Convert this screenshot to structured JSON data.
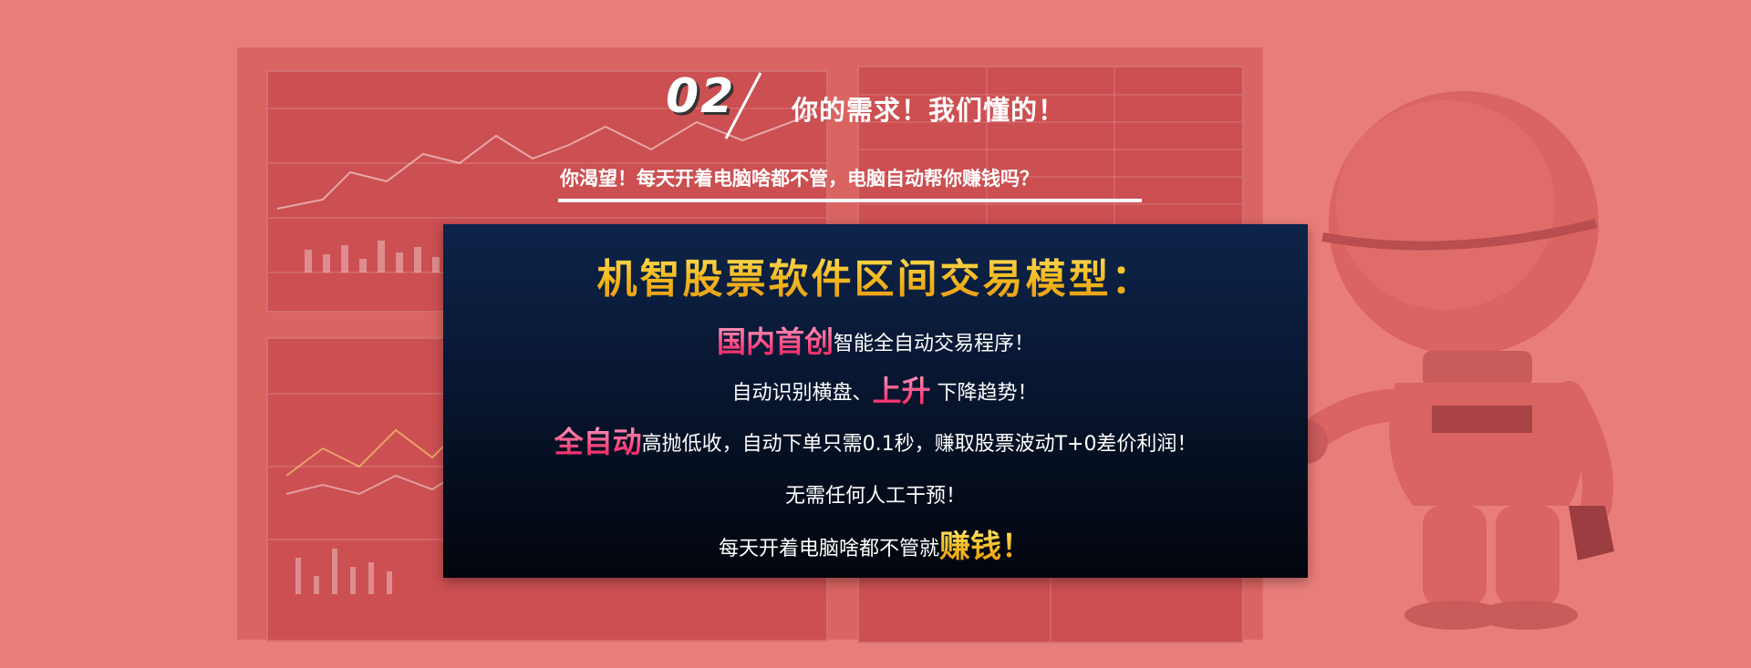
{
  "header": {
    "section_number": "02",
    "title": "你的需求！我们懂的！",
    "subtitle": "你渴望！每天开着电脑啥都不管，电脑自动帮你赚钱吗？"
  },
  "panel": {
    "title": "机智股票软件区间交易模型：",
    "lines": [
      {
        "highlight": "国内首创",
        "text": "智能全自动交易程序！"
      },
      {
        "text_before": "自动识别横盘、",
        "highlight": "上升",
        "text_after": "下降趋势！"
      },
      {
        "highlight": "全自动",
        "text": "高抛低收，自动下单只需0.1秒，赚取股票波动T+0差价利润！"
      },
      {
        "text": "无需任何人工干预！"
      },
      {
        "text": "每天开着电脑啥都不管就",
        "highlight": "赚钱！"
      }
    ]
  },
  "colors": {
    "background": "#e97d7a",
    "panel_top": "#0d2449",
    "panel_bottom": "#02050c",
    "accent_gold": "#f6c019",
    "accent_pink": "#ff3d78"
  },
  "decorations": {
    "monitor": "stock-monitor-illustration",
    "robot": "robot-mascot-illustration"
  }
}
